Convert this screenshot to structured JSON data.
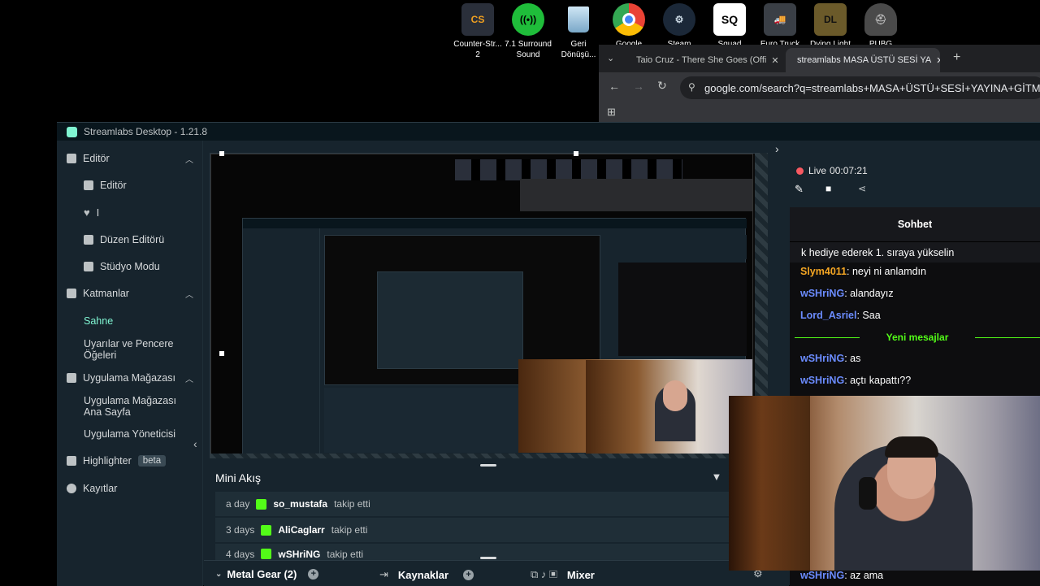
{
  "desktop_icons": [
    {
      "label": "Counter-Str...\n2",
      "icon": "counter-strike-icon",
      "color": "#2a2f3a"
    },
    {
      "label": "7.1 Surround\nSound",
      "icon": "surround-sound-icon",
      "color": "#1fbd3a"
    },
    {
      "label": "Geri\nDönüşü...",
      "icon": "recycle-bin-icon",
      "color": "#2a3a4a"
    },
    {
      "label": "Google",
      "icon": "chrome-icon",
      "color": "#e33b2e"
    },
    {
      "label": "Steam",
      "icon": "steam-icon",
      "color": "#1b2838"
    },
    {
      "label": "Squad",
      "icon": "squad-icon",
      "color": "#111111"
    },
    {
      "label": "Euro Truck",
      "icon": "euro-truck-icon",
      "color": "#3a3f46"
    },
    {
      "label": "Dying Light",
      "icon": "dying-light-icon",
      "color": "#6b5a2a"
    },
    {
      "label": "PUBG",
      "icon": "pubg-icon",
      "color": "#3a3a3a"
    }
  ],
  "chrome": {
    "tabs": [
      {
        "title": "Taio Cruz - There She Goes (Offi",
        "active": false
      },
      {
        "title": "streamlabs MASA ÜSTÜ SESİ YA",
        "active": true
      }
    ],
    "url": "google.com/search?q=streamlabs+MASA+ÜSTÜ+SESİ+YAYINA+GİTMİYOR&oq="
  },
  "streamlabs": {
    "title": "Streamlabs Desktop - 1.21.8",
    "sidebar": {
      "sections": [
        {
          "label": "Editör",
          "icon": "editor-icon"
        },
        {
          "label": "Katmanlar",
          "icon": "layers-icon"
        },
        {
          "label": "Uygulama Mağazası",
          "icon": "store-icon"
        }
      ],
      "items": [
        {
          "label": "Editör",
          "icon": "editor-sub-icon"
        },
        {
          "label": "I",
          "icon": "heart-icon"
        },
        {
          "label": "Düzen Editörü",
          "icon": "layout-editor-icon"
        },
        {
          "label": "Stüdyo Modu",
          "icon": "studio-mode-icon"
        },
        {
          "label": "Sahne"
        },
        {
          "label": "Uyarılar ve Pencere Öğeleri"
        },
        {
          "label": "Uygulama Mağazası Ana Sayfa"
        },
        {
          "label": "Uygulama Yöneticisi"
        },
        {
          "label": "Highlighter",
          "badge": "beta"
        },
        {
          "label": "Kayıtlar"
        }
      ]
    },
    "mini_feed": {
      "title": "Mini Akış",
      "events": [
        {
          "time": "a day",
          "user": "so_mustafa",
          "action": "takip etti"
        },
        {
          "time": "3 days",
          "user": "AliCaglarr",
          "action": "takip etti"
        },
        {
          "time": "4 days",
          "user": "wSHriNG",
          "action": "takip etti"
        }
      ]
    },
    "dock": {
      "scene": "Metal Gear (2)",
      "sources": "Kaynaklar",
      "mixer": "Mixer"
    },
    "live": {
      "label": "Live",
      "time": "00:07:21"
    },
    "chat": {
      "title": "Sohbet",
      "pinned": "k hediye ederek 1. sıraya yükselin",
      "new_messages": "Yeni mesajlar",
      "messages": [
        {
          "user": "Slym4011",
          "text": "neyi ni anlamdın",
          "color": "#f5a623"
        },
        {
          "user": "wSHriNG",
          "text": "alandayız",
          "color": "#6b8cff"
        },
        {
          "user": "Lord_Asriel",
          "text": "Saa",
          "color": "#6b8cff"
        },
        {
          "user": "wSHriNG",
          "text": "as",
          "color": "#6b8cff"
        },
        {
          "user": "wSHriNG",
          "text": "açtı kapattı??",
          "color": "#6b8cff"
        },
        {
          "user": "wSHriNG",
          "text": "az ama",
          "color": "#6b8cff"
        }
      ]
    }
  }
}
